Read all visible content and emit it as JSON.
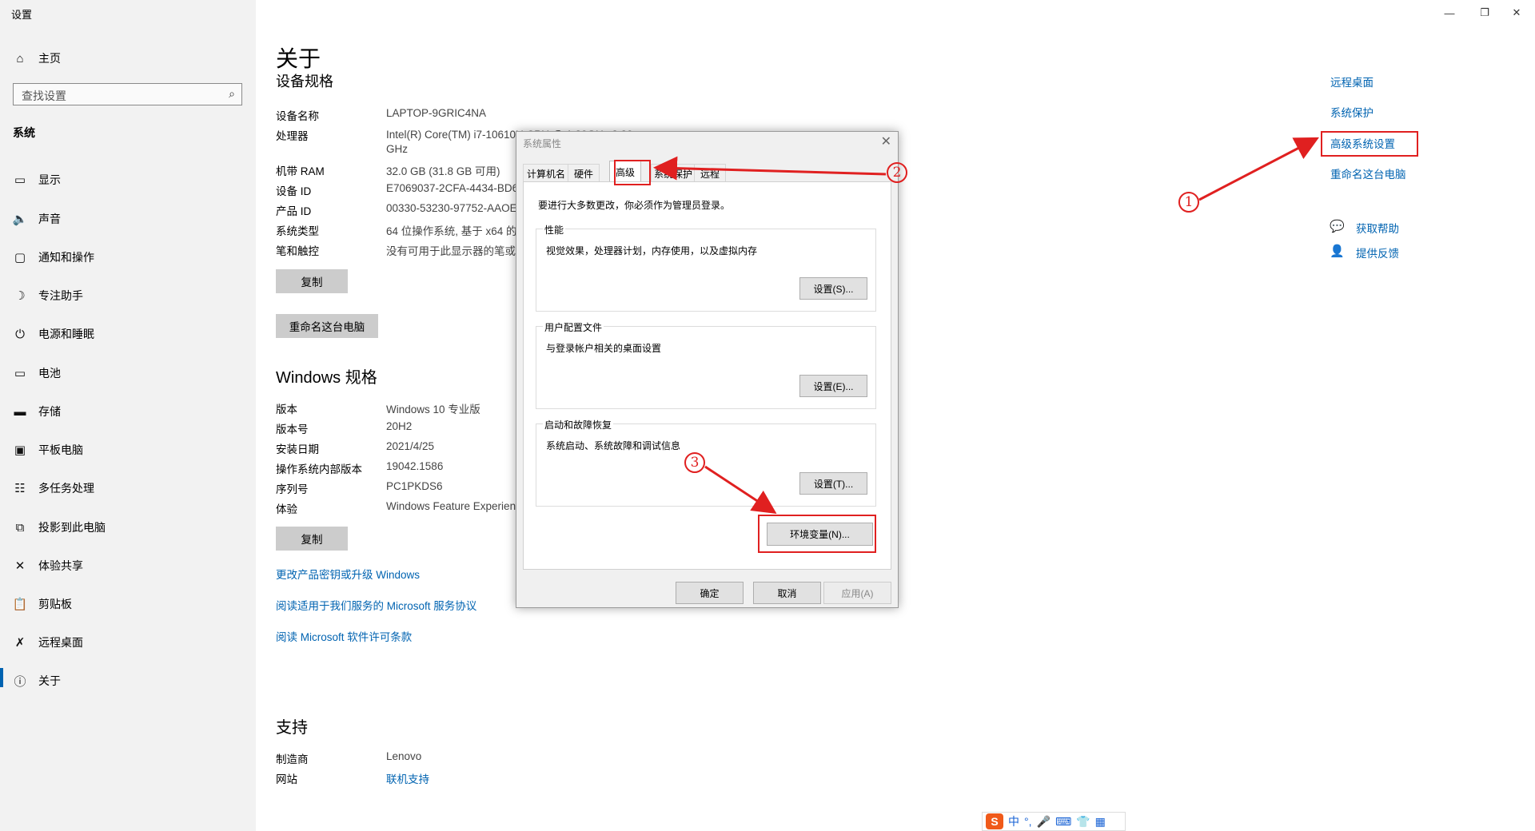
{
  "window": {
    "title": "设置",
    "controls": [
      "—",
      "❐",
      "✕"
    ]
  },
  "sidebar": {
    "home": "主页",
    "search_placeholder": "查找设置",
    "section": "系统",
    "items": [
      {
        "label": "显示",
        "icon": "monitor-icon"
      },
      {
        "label": "声音",
        "icon": "speaker-icon"
      },
      {
        "label": "通知和操作",
        "icon": "notification-icon"
      },
      {
        "label": "专注助手",
        "icon": "moon-icon"
      },
      {
        "label": "电源和睡眠",
        "icon": "power-icon"
      },
      {
        "label": "电池",
        "icon": "battery-icon"
      },
      {
        "label": "存储",
        "icon": "storage-icon"
      },
      {
        "label": "平板电脑",
        "icon": "tablet-icon"
      },
      {
        "label": "多任务处理",
        "icon": "multitask-icon"
      },
      {
        "label": "投影到此电脑",
        "icon": "project-icon"
      },
      {
        "label": "体验共享",
        "icon": "share-icon"
      },
      {
        "label": "剪贴板",
        "icon": "clipboard-icon"
      },
      {
        "label": "远程桌面",
        "icon": "remote-icon"
      },
      {
        "label": "关于",
        "icon": "info-icon"
      }
    ]
  },
  "main": {
    "title": "关于",
    "device_heading": "设备规格",
    "device_specs": [
      {
        "label": "设备名称",
        "value": "LAPTOP-9GRIC4NA"
      },
      {
        "label": "处理器",
        "value": "Intel(R) Core(TM) i7-10610U CPU @ 1.80GHz   2.30",
        "value2": "GHz"
      },
      {
        "label": "机带 RAM",
        "value": "32.0 GB (31.8 GB 可用)"
      },
      {
        "label": "设备 ID",
        "value": "E7069037-2CFA-4434-BD6"
      },
      {
        "label": "产品 ID",
        "value": "00330-53230-97752-AAOE"
      },
      {
        "label": "系统类型",
        "value": "64 位操作系统, 基于 x64 的"
      },
      {
        "label": "笔和触控",
        "value": "没有可用于此显示器的笔或"
      }
    ],
    "copy1": "复制",
    "rename": "重命名这台电脑",
    "win_heading": "Windows 规格",
    "win_specs": [
      {
        "label": "版本",
        "value": "Windows 10 专业版"
      },
      {
        "label": "版本号",
        "value": "20H2"
      },
      {
        "label": "安装日期",
        "value": "2021/4/25"
      },
      {
        "label": "操作系统内部版本",
        "value": "19042.1586"
      },
      {
        "label": "序列号",
        "value": "PC1PKDS6"
      },
      {
        "label": "体验",
        "value": "Windows Feature Experien"
      }
    ],
    "copy2": "复制",
    "links": [
      "更改产品密钥或升级 Windows",
      "阅读适用于我们服务的 Microsoft 服务协议",
      "阅读 Microsoft 软件许可条款"
    ],
    "support_heading": "支持",
    "support": [
      {
        "label": "制造商",
        "value": "Lenovo"
      },
      {
        "label": "网站",
        "value": "联机支持"
      }
    ]
  },
  "right": {
    "links": [
      "远程桌面",
      "系统保护",
      "高级系统设置",
      "重命名这台电脑"
    ],
    "help": "获取帮助",
    "feedback": "提供反馈"
  },
  "dialog": {
    "title": "系统属性",
    "tabs": [
      "计算机名",
      "硬件",
      "高级",
      "系统保护",
      "远程"
    ],
    "active_tab": "高级",
    "admin_note": "要进行大多数更改，你必须作为管理员登录。",
    "perf_title": "性能",
    "perf_desc": "视觉效果，处理器计划，内存使用，以及虚拟内存",
    "perf_btn": "设置(S)...",
    "profile_title": "用户配置文件",
    "profile_desc": "与登录帐户相关的桌面设置",
    "profile_btn": "设置(E)...",
    "startup_title": "启动和故障恢复",
    "startup_desc": "系统启动、系统故障和调试信息",
    "startup_btn": "设置(T)...",
    "env_btn": "环境变量(N)...",
    "ok": "确定",
    "cancel": "取消",
    "apply": "应用(A)"
  },
  "annotations": {
    "one": "1",
    "two": "2",
    "three": "3",
    "color": "#e02020"
  },
  "ime": {
    "logo": "S",
    "mode": "中",
    "punct": "°,",
    "mic": "🎤",
    "kbd": "⌨",
    "skin": "👕",
    "tools": "▦"
  }
}
